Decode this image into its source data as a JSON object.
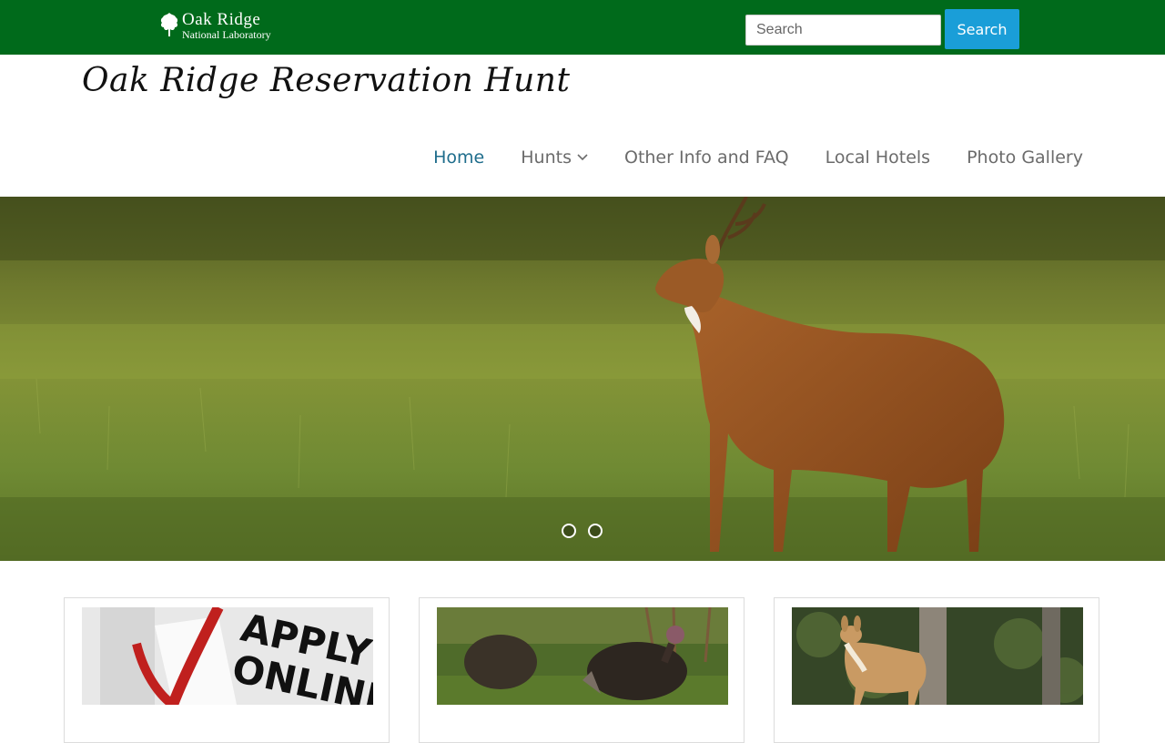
{
  "header": {
    "logo": {
      "name": "oak-ridge-logo",
      "line1": "Oak Ridge",
      "line2": "National Laboratory"
    },
    "search": {
      "placeholder": "Search",
      "button_label": "Search"
    },
    "site_title": "Oak Ridge Reservation Hunt"
  },
  "nav": {
    "items": [
      {
        "label": "Home",
        "active": true
      },
      {
        "label": "Hunts",
        "has_dropdown": true
      },
      {
        "label": "Other Info and FAQ"
      },
      {
        "label": "Local Hotels"
      },
      {
        "label": "Photo Gallery"
      }
    ]
  },
  "hero": {
    "slide_count": 2,
    "current_slide": 1
  },
  "cards": [
    {
      "image": "apply-online-image",
      "image_text": "APPLY ONLINE"
    },
    {
      "image": "wild-turkeys-image"
    },
    {
      "image": "deer-in-woods-image"
    }
  ],
  "colors": {
    "topbar": "#006a1b",
    "search_button": "#1a9ed8",
    "nav_active": "#1f6d8c",
    "nav_text": "#6b6b6b"
  }
}
